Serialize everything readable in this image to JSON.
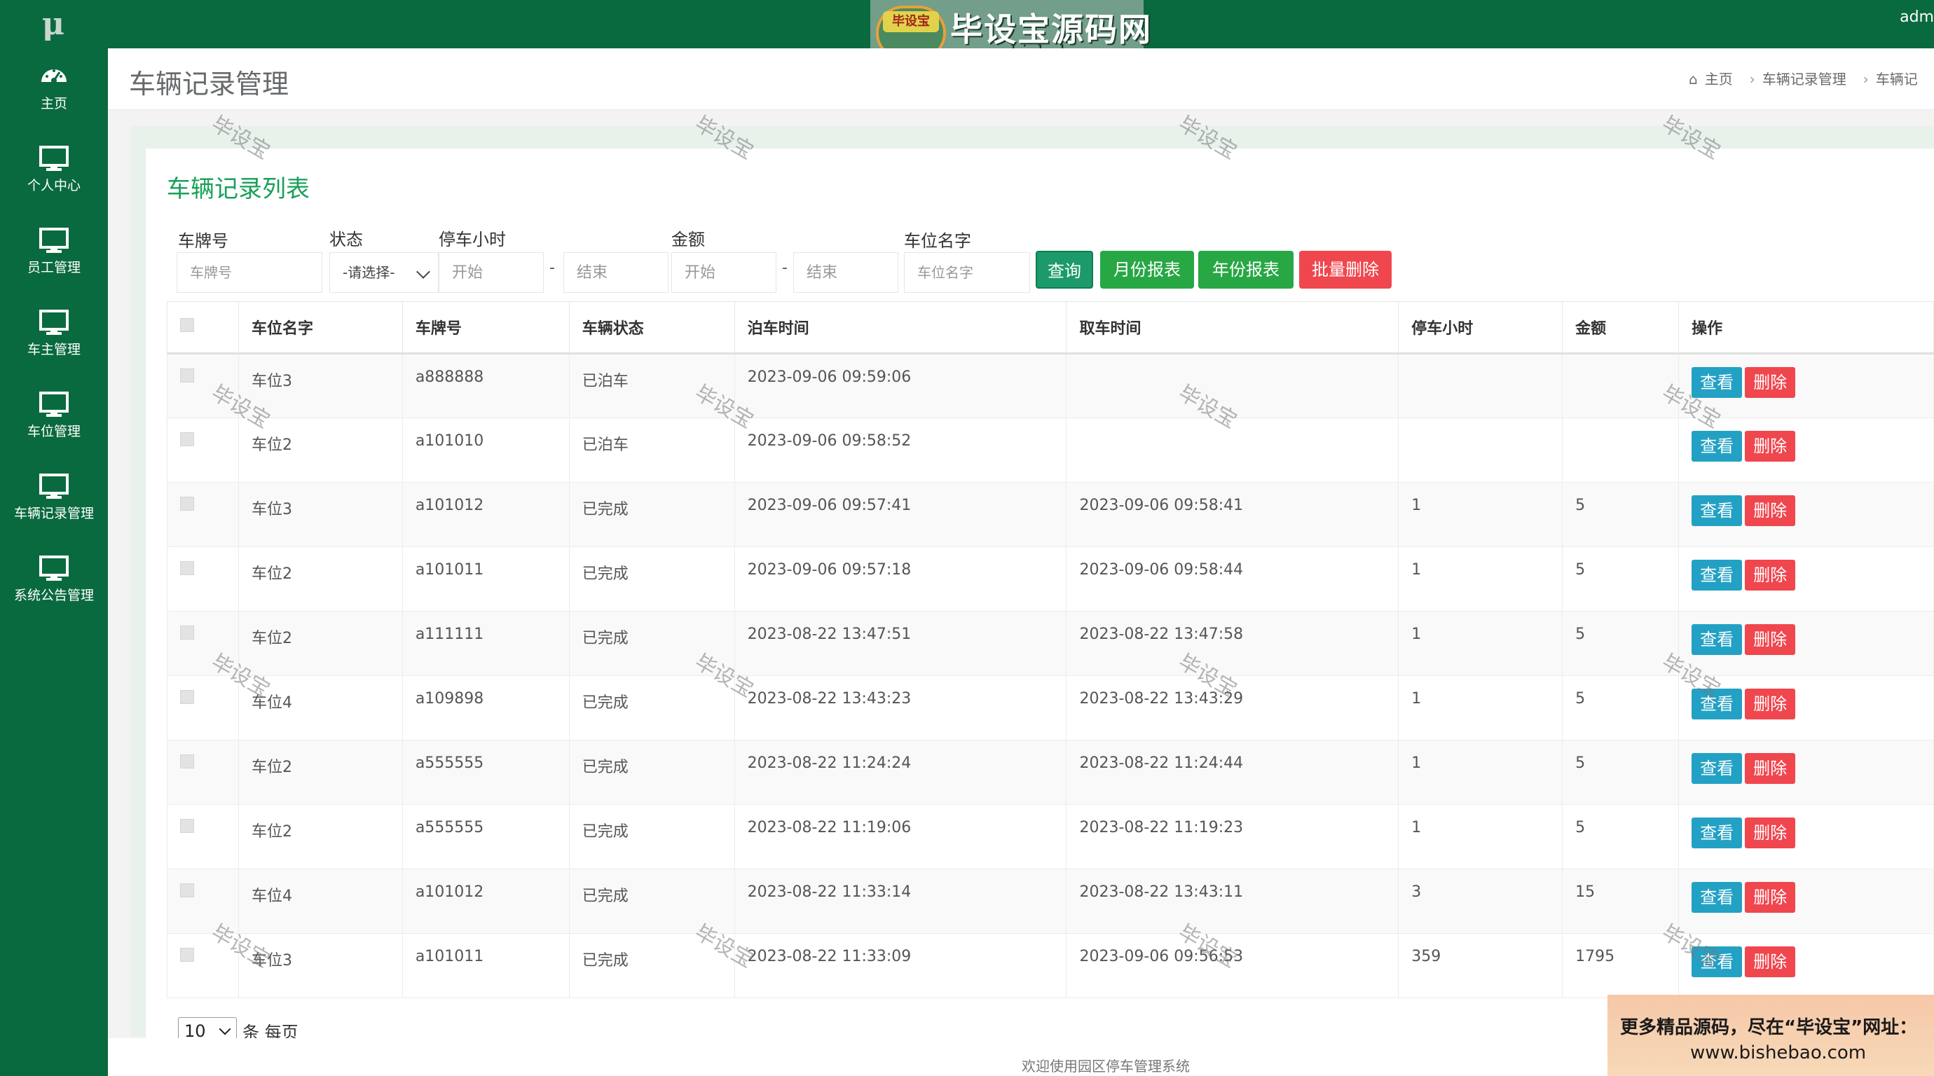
{
  "app": {
    "logo_text": "μ",
    "banner_badge": "毕设宝",
    "banner_title": "毕设宝源码网",
    "banner_url": "www.bishebao.com",
    "user_name": "adm"
  },
  "sidebar": {
    "items": [
      {
        "label": "主页",
        "icon": "dashboard-icon"
      },
      {
        "label": "个人中心",
        "icon": "monitor-icon"
      },
      {
        "label": "员工管理",
        "icon": "monitor-icon"
      },
      {
        "label": "车主管理",
        "icon": "monitor-icon"
      },
      {
        "label": "车位管理",
        "icon": "monitor-icon"
      },
      {
        "label": "车辆记录管理",
        "icon": "monitor-icon"
      },
      {
        "label": "系统公告管理",
        "icon": "monitor-icon"
      }
    ]
  },
  "header": {
    "title": "车辆记录管理",
    "breadcrumb": [
      "主页",
      "车辆记录管理",
      "车辆记"
    ]
  },
  "panel": {
    "title": "车辆记录列表"
  },
  "filters": {
    "plate_label": "车牌号",
    "plate_placeholder": "车牌号",
    "status_label": "状态",
    "status_value": "-请选择-",
    "hours_label": "停车小时",
    "hours_start_placeholder": "开始",
    "hours_end_placeholder": "结束",
    "amount_label": "金额",
    "amount_start_placeholder": "开始",
    "amount_end_placeholder": "结束",
    "spot_label": "车位名字",
    "spot_placeholder": "车位名字",
    "dash": "-"
  },
  "buttons": {
    "query": "查询",
    "monthly": "月份报表",
    "yearly": "年份报表",
    "batch_delete": "批量删除",
    "view": "查看",
    "delete": "删除"
  },
  "table": {
    "columns": [
      "车位名字",
      "车牌号",
      "车辆状态",
      "泊车时间",
      "取车时间",
      "停车小时",
      "金额",
      "操作"
    ],
    "rows": [
      {
        "spot": "车位3",
        "plate": "a888888",
        "status": "已泊车",
        "park_time": "2023-09-06 09:59:06",
        "pickup_time": "",
        "hours": "",
        "amount": ""
      },
      {
        "spot": "车位2",
        "plate": "a101010",
        "status": "已泊车",
        "park_time": "2023-09-06 09:58:52",
        "pickup_time": "",
        "hours": "",
        "amount": ""
      },
      {
        "spot": "车位3",
        "plate": "a101012",
        "status": "已完成",
        "park_time": "2023-09-06 09:57:41",
        "pickup_time": "2023-09-06 09:58:41",
        "hours": "1",
        "amount": "5"
      },
      {
        "spot": "车位2",
        "plate": "a101011",
        "status": "已完成",
        "park_time": "2023-09-06 09:57:18",
        "pickup_time": "2023-09-06 09:58:44",
        "hours": "1",
        "amount": "5"
      },
      {
        "spot": "车位2",
        "plate": "a111111",
        "status": "已完成",
        "park_time": "2023-08-22 13:47:51",
        "pickup_time": "2023-08-22 13:47:58",
        "hours": "1",
        "amount": "5"
      },
      {
        "spot": "车位4",
        "plate": "a109898",
        "status": "已完成",
        "park_time": "2023-08-22 13:43:23",
        "pickup_time": "2023-08-22 13:43:29",
        "hours": "1",
        "amount": "5"
      },
      {
        "spot": "车位2",
        "plate": "a555555",
        "status": "已完成",
        "park_time": "2023-08-22 11:24:24",
        "pickup_time": "2023-08-22 11:24:44",
        "hours": "1",
        "amount": "5"
      },
      {
        "spot": "车位2",
        "plate": "a555555",
        "status": "已完成",
        "park_time": "2023-08-22 11:19:06",
        "pickup_time": "2023-08-22 11:19:23",
        "hours": "1",
        "amount": "5"
      },
      {
        "spot": "车位4",
        "plate": "a101012",
        "status": "已完成",
        "park_time": "2023-08-22 11:33:14",
        "pickup_time": "2023-08-22 13:43:11",
        "hours": "3",
        "amount": "15"
      },
      {
        "spot": "车位3",
        "plate": "a101011",
        "status": "已完成",
        "park_time": "2023-08-22 11:33:09",
        "pickup_time": "2023-09-06 09:56:53",
        "hours": "359",
        "amount": "1795"
      }
    ]
  },
  "pagination": {
    "page_size": "10",
    "page_size_suffix": "条 每页"
  },
  "footer": {
    "text": "欢迎使用园区停车管理系统"
  },
  "promo": {
    "line1": "更多精品源码，尽在“毕设宝”网址：",
    "line2": "www.bishebao.com"
  },
  "watermark": {
    "text": "毕设宝"
  }
}
